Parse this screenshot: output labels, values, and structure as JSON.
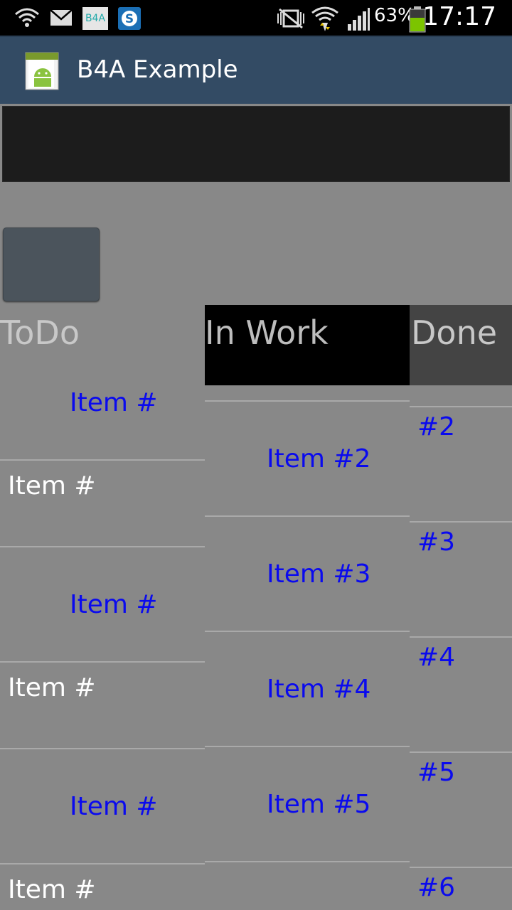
{
  "status_bar": {
    "battery_percent": "63%",
    "clock": "17:17",
    "notification_b4a": "B4A",
    "icons": [
      "wifi-signal-icon",
      "mail-icon",
      "b4a-notification-icon",
      "skype-icon",
      "mute-vibrate-icon",
      "wifi-icon",
      "cell-signal-icon",
      "battery-icon"
    ]
  },
  "action_bar": {
    "title": "B4A Example",
    "icon": "android-app-icon"
  },
  "headers": {
    "todo": "ToDo",
    "in_work": "In Work",
    "done": "Done"
  },
  "todo_items": [
    {
      "label": "Item #",
      "style": "blue-centered"
    },
    {
      "label": "Item #",
      "style": "white-left"
    },
    {
      "label": "Item #",
      "style": "blue-centered"
    },
    {
      "label": "Item #",
      "style": "white-left"
    },
    {
      "label": "Item #",
      "style": "blue-centered"
    },
    {
      "label": "Item #",
      "style": "white-left"
    }
  ],
  "in_work_items": [
    "Item #2",
    "Item #3",
    "Item #4",
    "Item #5"
  ],
  "done_items": [
    "#2",
    "#3",
    "#4",
    "#5",
    "#6"
  ],
  "colors": {
    "background": "#888888",
    "action_bar": "#334b64",
    "item_blue": "#0a0aee",
    "header_in_work_bg": "#000000",
    "header_done_bg": "#444444"
  }
}
